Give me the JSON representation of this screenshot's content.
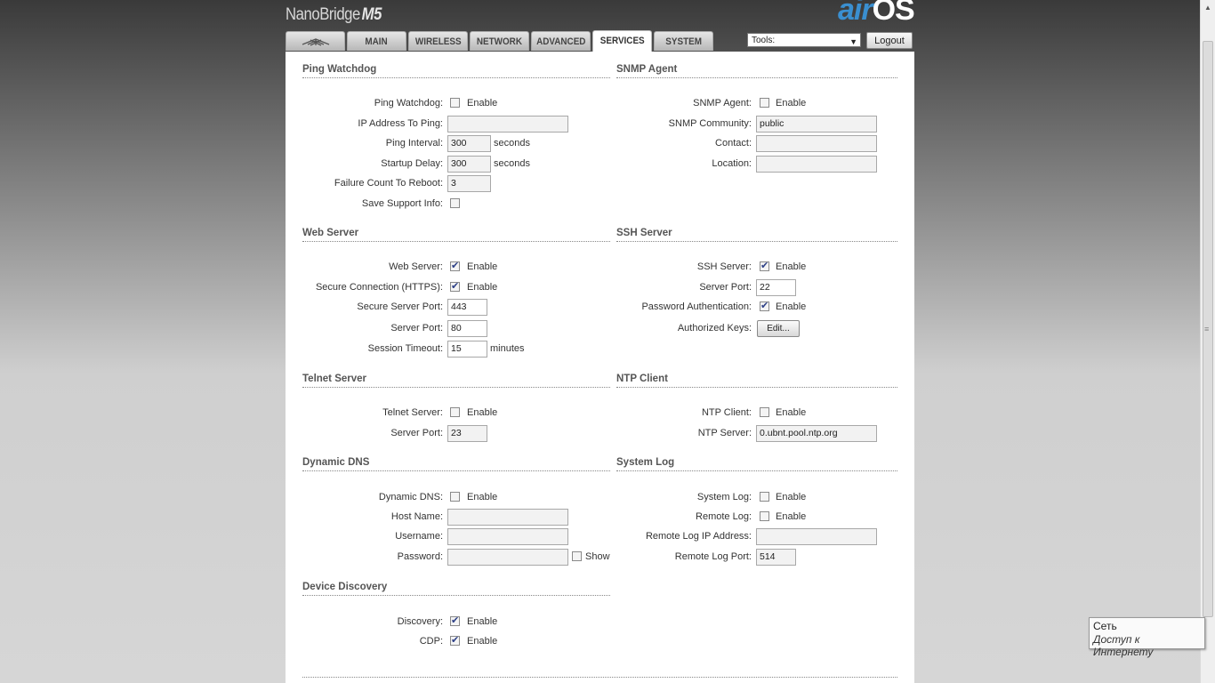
{
  "header": {
    "brand_name": "NanoBridge",
    "brand_model": "M5",
    "logo_air": "air",
    "logo_os": "OS"
  },
  "tabs": [
    "MAIN",
    "WIRELESS",
    "NETWORK",
    "ADVANCED",
    "SERVICES",
    "SYSTEM"
  ],
  "active_tab": "SERVICES",
  "tools": {
    "label": "Tools:"
  },
  "logout_label": "Logout",
  "ping_watchdog": {
    "title": "Ping Watchdog",
    "ping_watchdog_label": "Ping Watchdog:",
    "ping_watchdog_enabled": false,
    "ip_label": "IP Address To Ping:",
    "ip_value": "",
    "interval_label": "Ping Interval:",
    "interval_value": "300",
    "startup_label": "Startup Delay:",
    "startup_value": "300",
    "failure_label": "Failure Count To Reboot:",
    "failure_value": "3",
    "save_support_label": "Save Support Info:",
    "save_support_enabled": false
  },
  "snmp": {
    "title": "SNMP Agent",
    "agent_label": "SNMP Agent:",
    "agent_enabled": false,
    "community_label": "SNMP Community:",
    "community_value": "public",
    "contact_label": "Contact:",
    "contact_value": "",
    "location_label": "Location:",
    "location_value": ""
  },
  "web_server": {
    "title": "Web Server",
    "web_label": "Web Server:",
    "web_enabled": true,
    "https_label": "Secure Connection (HTTPS):",
    "https_enabled": true,
    "secure_port_label": "Secure Server Port:",
    "secure_port_value": "443",
    "port_label": "Server Port:",
    "port_value": "80",
    "timeout_label": "Session Timeout:",
    "timeout_value": "15"
  },
  "ssh_server": {
    "title": "SSH Server",
    "ssh_label": "SSH Server:",
    "ssh_enabled": true,
    "port_label": "Server Port:",
    "port_value": "22",
    "pwd_auth_label": "Password Authentication:",
    "pwd_auth_enabled": true,
    "keys_label": "Authorized Keys:",
    "edit_label": "Edit..."
  },
  "telnet": {
    "title": "Telnet Server",
    "telnet_label": "Telnet Server:",
    "telnet_enabled": false,
    "port_label": "Server Port:",
    "port_value": "23"
  },
  "ntp": {
    "title": "NTP Client",
    "client_label": "NTP Client:",
    "client_enabled": false,
    "server_label": "NTP Server:",
    "server_value": "0.ubnt.pool.ntp.org"
  },
  "ddns": {
    "title": "Dynamic DNS",
    "ddns_label": "Dynamic DNS:",
    "ddns_enabled": false,
    "host_label": "Host Name:",
    "host_value": "",
    "user_label": "Username:",
    "user_value": "",
    "pass_label": "Password:",
    "pass_value": "",
    "show_label": "Show",
    "show_enabled": false
  },
  "syslog": {
    "title": "System Log",
    "syslog_label": "System Log:",
    "syslog_enabled": false,
    "remote_label": "Remote Log:",
    "remote_enabled": false,
    "remote_ip_label": "Remote Log IP Address:",
    "remote_ip_value": "",
    "remote_port_label": "Remote Log Port:",
    "remote_port_value": "514"
  },
  "discovery": {
    "title": "Device Discovery",
    "discovery_label": "Discovery:",
    "discovery_enabled": true,
    "cdp_label": "CDP:",
    "cdp_enabled": true
  },
  "common": {
    "enable": "Enable",
    "seconds": "seconds",
    "minutes": "minutes"
  },
  "tooltip": {
    "line1": "Сеть",
    "line2": "Доступ к Интернету"
  }
}
